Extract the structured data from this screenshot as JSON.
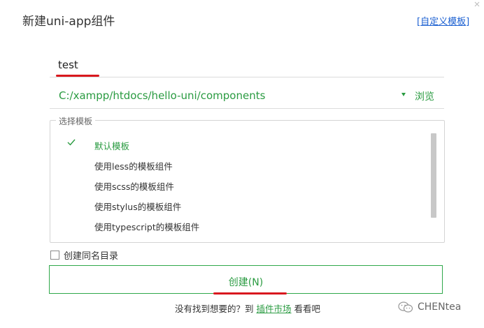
{
  "dialog": {
    "title": "新建uni-app组件",
    "custom_template_link": "自定义模板",
    "custom_template_bracket_open": "[",
    "custom_template_bracket_close": "]"
  },
  "name_input": {
    "value": "test"
  },
  "path": {
    "value": "C:/xampp/htdocs/hello-uni/components",
    "browse_label": "浏览"
  },
  "templates": {
    "legend": "选择模板",
    "items": [
      {
        "label": "默认模板",
        "selected": true
      },
      {
        "label": "使用less的模板组件",
        "selected": false
      },
      {
        "label": "使用scss的模板组件",
        "selected": false
      },
      {
        "label": "使用stylus的模板组件",
        "selected": false
      },
      {
        "label": "使用typescript的模板组件",
        "selected": false
      }
    ]
  },
  "create_dir": {
    "label": "创建同名目录",
    "checked": false
  },
  "create_button": {
    "label": "创建(N)"
  },
  "footer": {
    "prefix": "没有找到想要的？到",
    "link": "插件市场",
    "suffix": "看看吧"
  },
  "watermark": {
    "text": "CHENtea",
    "icon": "wechat-icon"
  },
  "colors": {
    "accent": "#2a9b41",
    "link": "#1a5fd1",
    "annotation_red": "#d9181e"
  }
}
